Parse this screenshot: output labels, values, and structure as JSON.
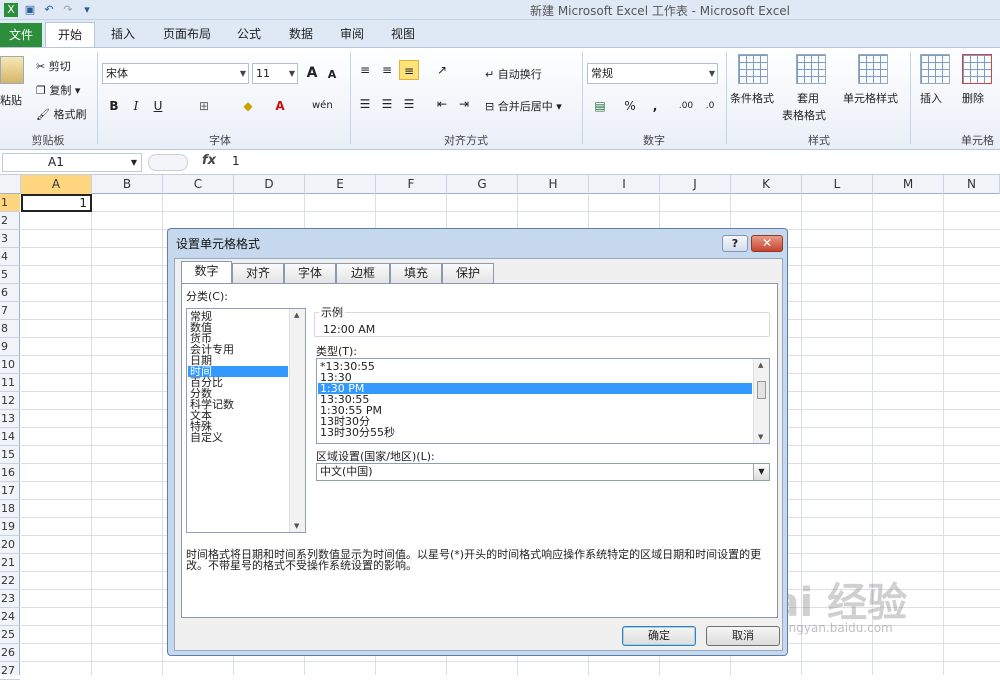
{
  "window": {
    "title": "新建 Microsoft Excel 工作表 - Microsoft Excel"
  },
  "tabs": [
    "文件",
    "开始",
    "插入",
    "页面布局",
    "公式",
    "数据",
    "审阅",
    "视图"
  ],
  "ribbon": {
    "clipboard": {
      "paste": "粘贴",
      "cut": "剪切",
      "copy": "复制",
      "painter": "格式刷",
      "label": "剪贴板"
    },
    "font": {
      "name": "宋体",
      "size": "11",
      "bold": "B",
      "italic": "I",
      "underline": "U",
      "grow": "A",
      "shrink": "A",
      "label": "字体"
    },
    "align": {
      "wrap": "自动换行",
      "merge": "合并后居中",
      "label": "对齐方式"
    },
    "number": {
      "format": "常规",
      "percent": "%",
      "comma": ",",
      "label": "数字"
    },
    "styles": {
      "cond": "条件格式",
      "table1": "套用",
      "table2": "表格格式",
      "cell": "单元格样式",
      "label": "样式"
    },
    "cells": {
      "insert": "插入",
      "delete": "删除",
      "label": "单元格"
    }
  },
  "formula": {
    "namebox": "A1",
    "fx": "fx",
    "value": "1"
  },
  "columns": [
    "A",
    "B",
    "C",
    "D",
    "E",
    "F",
    "G",
    "H",
    "I",
    "J",
    "K",
    "L",
    "M",
    "N"
  ],
  "rows": [
    "1",
    "2",
    "3",
    "4",
    "5",
    "6",
    "7",
    "8",
    "9",
    "10",
    "11",
    "12",
    "13",
    "14",
    "15",
    "16",
    "17",
    "18",
    "19",
    "20",
    "21",
    "22",
    "23",
    "24",
    "25",
    "26",
    "27"
  ],
  "cell_a1": "1",
  "dialog": {
    "title": "设置单元格格式",
    "help": "?",
    "close": "✕",
    "tabs": [
      "数字",
      "对齐",
      "字体",
      "边框",
      "填充",
      "保护"
    ],
    "category_label": "分类(C):",
    "categories": [
      "常规",
      "数值",
      "货币",
      "会计专用",
      "日期",
      "时间",
      "百分比",
      "分数",
      "科学记数",
      "文本",
      "特殊",
      "自定义"
    ],
    "sample_label": "示例",
    "sample_value": "12:00 AM",
    "type_label": "类型(T):",
    "types": [
      "*13:30:55",
      "13:30",
      "1:30 PM",
      "13:30:55",
      "1:30:55 PM",
      "13时30分",
      "13时30分55秒"
    ],
    "locale_label": "区域设置(国家/地区)(L):",
    "locale_value": "中文(中国)",
    "description": "时间格式将日期和时间系列数值显示为时间值。以星号(*)开头的时间格式响应操作系统特定的区域日期和时间设置的更改。不带星号的格式不受操作系统设置的影响。",
    "ok": "确定",
    "cancel": "取消"
  },
  "watermark": {
    "brand": "Bai 经验",
    "url": "jingyan.baidu.com"
  }
}
